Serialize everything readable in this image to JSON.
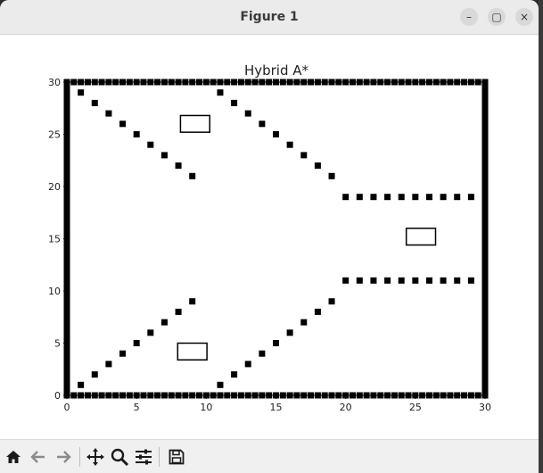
{
  "window": {
    "title": "Figure 1",
    "controls": {
      "minimize": "–",
      "maximize": "▢",
      "close": "×"
    }
  },
  "toolbar": {
    "icons": [
      "home-icon",
      "back-arrow-icon",
      "forward-arrow-icon",
      "pan-icon",
      "zoom-icon",
      "configure-subplots-icon",
      "save-icon"
    ]
  },
  "chart_data": {
    "type": "scatter",
    "title": "Hybrid A*",
    "xlim": [
      0,
      30
    ],
    "ylim": [
      0,
      30
    ],
    "xticks": [
      "0",
      "5",
      "10",
      "15",
      "20",
      "25",
      "30"
    ],
    "yticks": [
      "0",
      "5",
      "10",
      "15",
      "20",
      "25",
      "30"
    ],
    "marker_color": "#000000",
    "obstacle_points": [
      [
        1,
        29
      ],
      [
        2,
        28
      ],
      [
        3,
        27
      ],
      [
        4,
        26
      ],
      [
        5,
        25
      ],
      [
        6,
        24
      ],
      [
        7,
        23
      ],
      [
        8,
        22
      ],
      [
        9,
        21
      ],
      [
        11,
        29
      ],
      [
        12,
        28
      ],
      [
        13,
        27
      ],
      [
        14,
        26
      ],
      [
        15,
        25
      ],
      [
        16,
        24
      ],
      [
        17,
        23
      ],
      [
        18,
        22
      ],
      [
        19,
        21
      ],
      [
        20,
        19
      ],
      [
        21,
        19
      ],
      [
        22,
        19
      ],
      [
        23,
        19
      ],
      [
        24,
        19
      ],
      [
        25,
        19
      ],
      [
        26,
        19
      ],
      [
        27,
        19
      ],
      [
        28,
        19
      ],
      [
        29,
        19
      ],
      [
        1,
        1
      ],
      [
        2,
        2
      ],
      [
        3,
        3
      ],
      [
        4,
        4
      ],
      [
        5,
        5
      ],
      [
        6,
        6
      ],
      [
        7,
        7
      ],
      [
        8,
        8
      ],
      [
        9,
        9
      ],
      [
        11,
        1
      ],
      [
        12,
        2
      ],
      [
        13,
        3
      ],
      [
        14,
        4
      ],
      [
        15,
        5
      ],
      [
        16,
        6
      ],
      [
        17,
        7
      ],
      [
        18,
        8
      ],
      [
        19,
        9
      ],
      [
        20,
        11
      ],
      [
        21,
        11
      ],
      [
        22,
        11
      ],
      [
        23,
        11
      ],
      [
        24,
        11
      ],
      [
        25,
        11
      ],
      [
        26,
        11
      ],
      [
        27,
        11
      ],
      [
        28,
        11
      ],
      [
        29,
        11
      ]
    ],
    "boundary": {
      "from": 0,
      "to": 30,
      "step": 0.5
    },
    "vehicles": [
      {
        "x": 9.2,
        "y": 26.0,
        "length": 2.1,
        "width": 1.6
      },
      {
        "x": 9.0,
        "y": 4.2,
        "length": 2.1,
        "width": 1.6
      },
      {
        "x": 25.4,
        "y": 15.2,
        "length": 2.1,
        "width": 1.6
      }
    ]
  }
}
